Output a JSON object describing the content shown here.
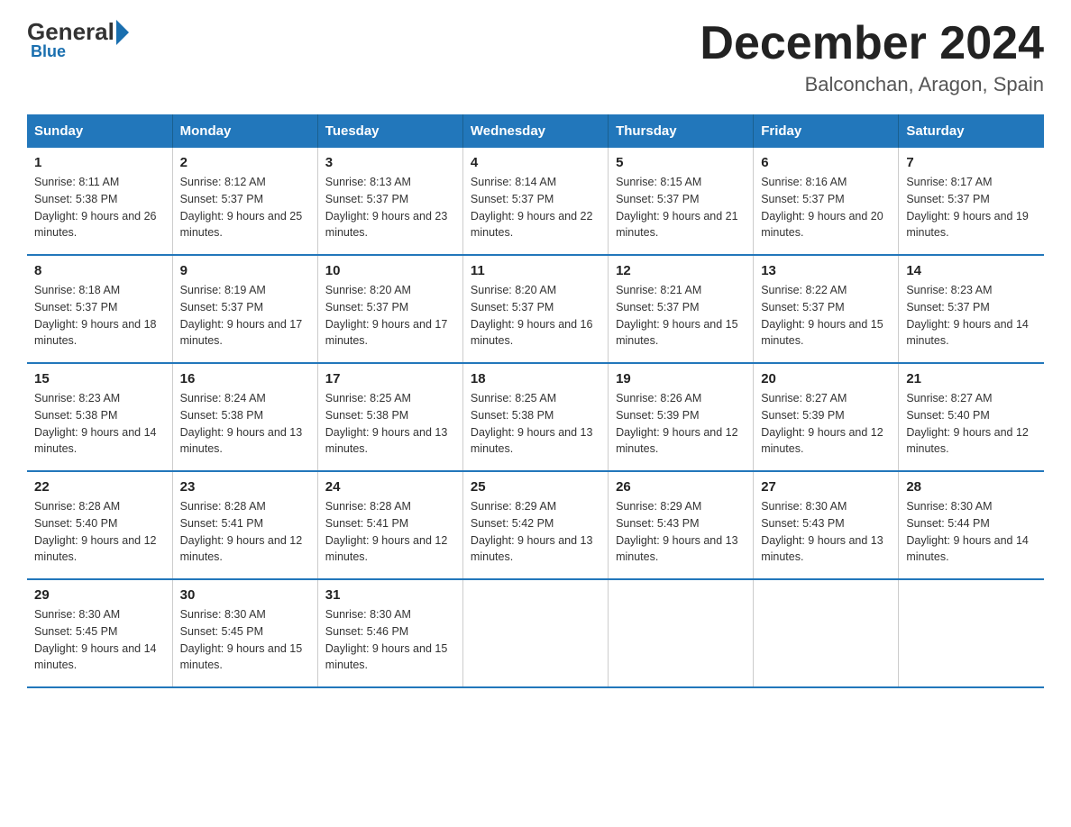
{
  "logo": {
    "text_general": "General",
    "text_blue": "Blue"
  },
  "header": {
    "title": "December 2024",
    "subtitle": "Balconchan, Aragon, Spain"
  },
  "days_of_week": [
    "Sunday",
    "Monday",
    "Tuesday",
    "Wednesday",
    "Thursday",
    "Friday",
    "Saturday"
  ],
  "weeks": [
    [
      {
        "day": "1",
        "sunrise": "8:11 AM",
        "sunset": "5:38 PM",
        "daylight": "9 hours and 26 minutes."
      },
      {
        "day": "2",
        "sunrise": "8:12 AM",
        "sunset": "5:37 PM",
        "daylight": "9 hours and 25 minutes."
      },
      {
        "day": "3",
        "sunrise": "8:13 AM",
        "sunset": "5:37 PM",
        "daylight": "9 hours and 23 minutes."
      },
      {
        "day": "4",
        "sunrise": "8:14 AM",
        "sunset": "5:37 PM",
        "daylight": "9 hours and 22 minutes."
      },
      {
        "day": "5",
        "sunrise": "8:15 AM",
        "sunset": "5:37 PM",
        "daylight": "9 hours and 21 minutes."
      },
      {
        "day": "6",
        "sunrise": "8:16 AM",
        "sunset": "5:37 PM",
        "daylight": "9 hours and 20 minutes."
      },
      {
        "day": "7",
        "sunrise": "8:17 AM",
        "sunset": "5:37 PM",
        "daylight": "9 hours and 19 minutes."
      }
    ],
    [
      {
        "day": "8",
        "sunrise": "8:18 AM",
        "sunset": "5:37 PM",
        "daylight": "9 hours and 18 minutes."
      },
      {
        "day": "9",
        "sunrise": "8:19 AM",
        "sunset": "5:37 PM",
        "daylight": "9 hours and 17 minutes."
      },
      {
        "day": "10",
        "sunrise": "8:20 AM",
        "sunset": "5:37 PM",
        "daylight": "9 hours and 17 minutes."
      },
      {
        "day": "11",
        "sunrise": "8:20 AM",
        "sunset": "5:37 PM",
        "daylight": "9 hours and 16 minutes."
      },
      {
        "day": "12",
        "sunrise": "8:21 AM",
        "sunset": "5:37 PM",
        "daylight": "9 hours and 15 minutes."
      },
      {
        "day": "13",
        "sunrise": "8:22 AM",
        "sunset": "5:37 PM",
        "daylight": "9 hours and 15 minutes."
      },
      {
        "day": "14",
        "sunrise": "8:23 AM",
        "sunset": "5:37 PM",
        "daylight": "9 hours and 14 minutes."
      }
    ],
    [
      {
        "day": "15",
        "sunrise": "8:23 AM",
        "sunset": "5:38 PM",
        "daylight": "9 hours and 14 minutes."
      },
      {
        "day": "16",
        "sunrise": "8:24 AM",
        "sunset": "5:38 PM",
        "daylight": "9 hours and 13 minutes."
      },
      {
        "day": "17",
        "sunrise": "8:25 AM",
        "sunset": "5:38 PM",
        "daylight": "9 hours and 13 minutes."
      },
      {
        "day": "18",
        "sunrise": "8:25 AM",
        "sunset": "5:38 PM",
        "daylight": "9 hours and 13 minutes."
      },
      {
        "day": "19",
        "sunrise": "8:26 AM",
        "sunset": "5:39 PM",
        "daylight": "9 hours and 12 minutes."
      },
      {
        "day": "20",
        "sunrise": "8:27 AM",
        "sunset": "5:39 PM",
        "daylight": "9 hours and 12 minutes."
      },
      {
        "day": "21",
        "sunrise": "8:27 AM",
        "sunset": "5:40 PM",
        "daylight": "9 hours and 12 minutes."
      }
    ],
    [
      {
        "day": "22",
        "sunrise": "8:28 AM",
        "sunset": "5:40 PM",
        "daylight": "9 hours and 12 minutes."
      },
      {
        "day": "23",
        "sunrise": "8:28 AM",
        "sunset": "5:41 PM",
        "daylight": "9 hours and 12 minutes."
      },
      {
        "day": "24",
        "sunrise": "8:28 AM",
        "sunset": "5:41 PM",
        "daylight": "9 hours and 12 minutes."
      },
      {
        "day": "25",
        "sunrise": "8:29 AM",
        "sunset": "5:42 PM",
        "daylight": "9 hours and 13 minutes."
      },
      {
        "day": "26",
        "sunrise": "8:29 AM",
        "sunset": "5:43 PM",
        "daylight": "9 hours and 13 minutes."
      },
      {
        "day": "27",
        "sunrise": "8:30 AM",
        "sunset": "5:43 PM",
        "daylight": "9 hours and 13 minutes."
      },
      {
        "day": "28",
        "sunrise": "8:30 AM",
        "sunset": "5:44 PM",
        "daylight": "9 hours and 14 minutes."
      }
    ],
    [
      {
        "day": "29",
        "sunrise": "8:30 AM",
        "sunset": "5:45 PM",
        "daylight": "9 hours and 14 minutes."
      },
      {
        "day": "30",
        "sunrise": "8:30 AM",
        "sunset": "5:45 PM",
        "daylight": "9 hours and 15 minutes."
      },
      {
        "day": "31",
        "sunrise": "8:30 AM",
        "sunset": "5:46 PM",
        "daylight": "9 hours and 15 minutes."
      },
      null,
      null,
      null,
      null
    ]
  ]
}
